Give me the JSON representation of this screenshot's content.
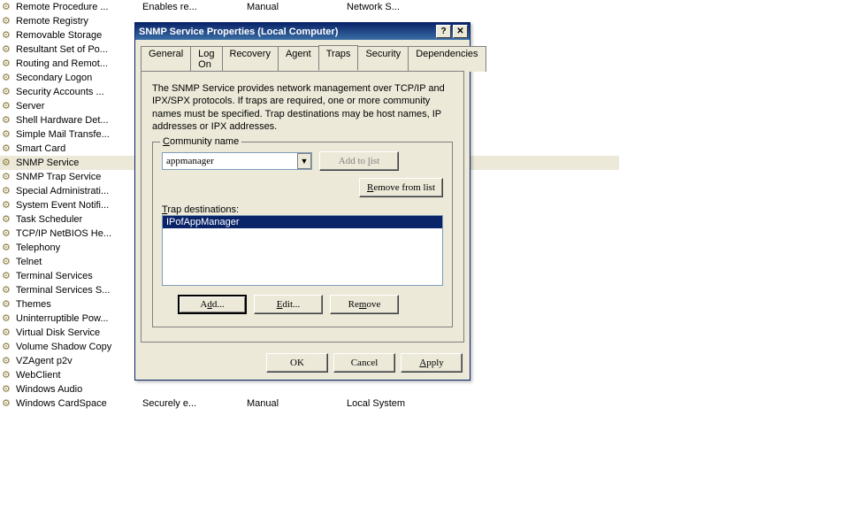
{
  "services": [
    {
      "name": "Remote Procedure ...",
      "desc": "Enables re...",
      "startup": "Manual",
      "logon": "Network S..."
    },
    {
      "name": "Remote Registry"
    },
    {
      "name": "Removable Storage"
    },
    {
      "name": "Resultant Set of Po..."
    },
    {
      "name": "Routing and Remot..."
    },
    {
      "name": "Secondary Logon"
    },
    {
      "name": "Security Accounts ..."
    },
    {
      "name": "Server"
    },
    {
      "name": "Shell Hardware Det..."
    },
    {
      "name": "Simple Mail Transfe..."
    },
    {
      "name": "Smart Card"
    },
    {
      "name": "SNMP Service",
      "selected": true
    },
    {
      "name": "SNMP Trap Service"
    },
    {
      "name": "Special Administrati..."
    },
    {
      "name": "System Event Notifi..."
    },
    {
      "name": "Task Scheduler"
    },
    {
      "name": "TCP/IP NetBIOS He..."
    },
    {
      "name": "Telephony"
    },
    {
      "name": "Telnet"
    },
    {
      "name": "Terminal Services"
    },
    {
      "name": "Terminal Services S..."
    },
    {
      "name": "Themes"
    },
    {
      "name": "Uninterruptible Pow..."
    },
    {
      "name": "Virtual Disk Service"
    },
    {
      "name": "Volume Shadow Copy"
    },
    {
      "name": "VZAgent p2v"
    },
    {
      "name": "WebClient"
    },
    {
      "name": "Windows Audio"
    },
    {
      "name": "Windows CardSpace",
      "desc": "Securely e...",
      "startup": "Manual",
      "logon": "Local System"
    }
  ],
  "dialog": {
    "title": "SNMP Service Properties (Local Computer)",
    "help_char": "?",
    "close_char": "✕",
    "tabs": [
      "General",
      "Log On",
      "Recovery",
      "Agent",
      "Traps",
      "Security",
      "Dependencies"
    ],
    "active_tab": "Traps",
    "description": "The SNMP Service provides network management over TCP/IP and IPX/SPX protocols. If traps are required, one or more community names must be specified. Trap destinations may be host names, IP addresses or IPX addresses.",
    "community_group": {
      "legend": "Community name",
      "value": "appmanager",
      "add_to_list": "Add to list",
      "remove_from_list": "Remove from list",
      "trap_dest_label": "Trap destinations:",
      "trap_items": [
        "IPofAppManager"
      ],
      "add": "Add...",
      "edit": "Edit...",
      "remove": "Remove"
    },
    "buttons": {
      "ok": "OK",
      "cancel": "Cancel",
      "apply": "Apply"
    }
  }
}
